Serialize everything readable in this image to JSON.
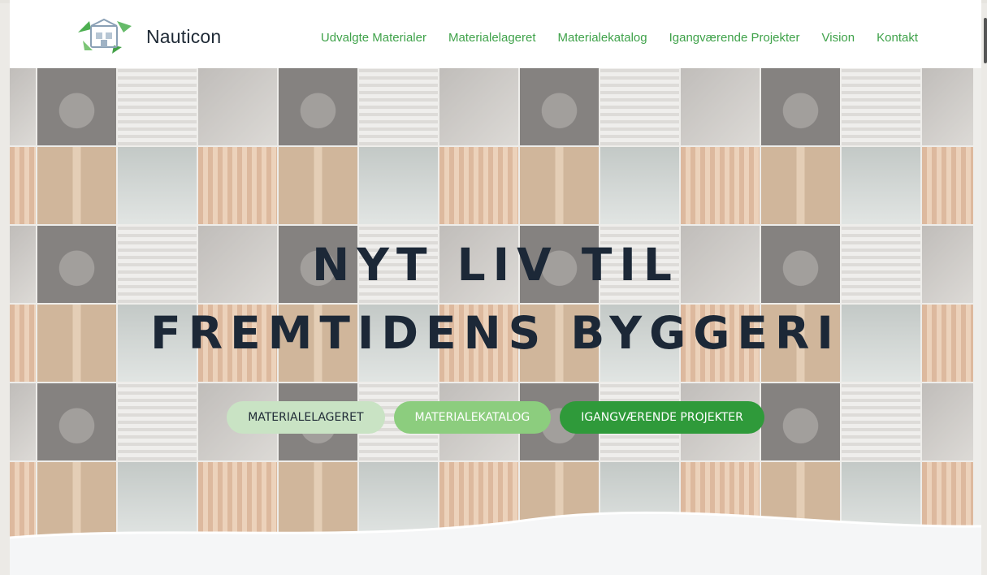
{
  "brand": {
    "name": "Nauticon",
    "logo_icon": "recycling-building-logo-icon",
    "accent_color": "#3fa24a",
    "text_color": "#1f2a36"
  },
  "nav": {
    "items": [
      {
        "label": "Udvalgte Materialer"
      },
      {
        "label": "Materialelageret"
      },
      {
        "label": "Materialekatalog"
      },
      {
        "label": "Igangværende Projekter"
      },
      {
        "label": "Vision"
      },
      {
        "label": "Kontakt"
      }
    ]
  },
  "hero": {
    "headline_line1": "NYT LIV TIL",
    "headline_line2": "FREMTIDENS BYGGERI",
    "buttons": [
      {
        "label": "MATERIALELAGERET",
        "color": "#c9e3c4"
      },
      {
        "label": "MATERIALEKATALOG",
        "color": "#8ccd7e"
      },
      {
        "label": "IGANGVÆRENDE PROJEKTER",
        "color": "#2f9a3a"
      }
    ],
    "background": "grid-of-building-material-photos"
  }
}
